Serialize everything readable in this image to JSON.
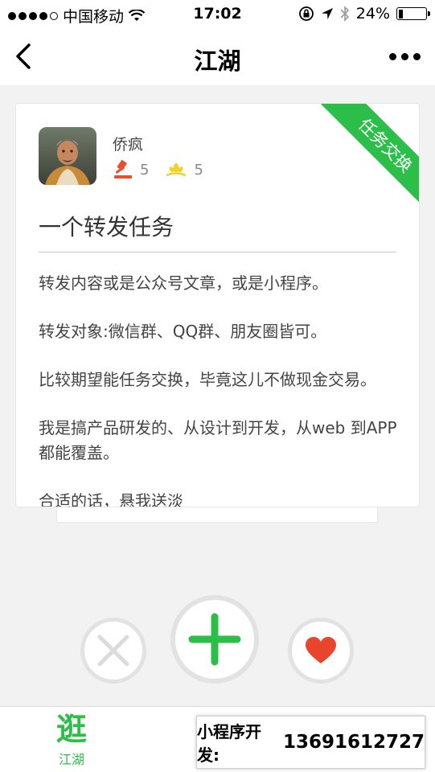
{
  "status_bar": {
    "carrier": "中国移动",
    "time": "17:02",
    "battery": "24%",
    "battery_level": 0.24
  },
  "nav": {
    "title": "江湖"
  },
  "card": {
    "ribbon": "任务交换",
    "username": "侨疯",
    "stat_hammer": "5",
    "stat_flower": "5",
    "title": "一个转发任务",
    "paragraphs": [
      "转发内容或是公众号文章，或是小程序。",
      "转发对象:微信群、QQ群、朋友圈皆可。",
      "比较期望能任务交换，毕竟这儿不做现金交易。",
      "我是搞产品研发的、从设计到开发，从web 到APP都能覆盖。",
      "合适的话，悬我送淡"
    ]
  },
  "tabbar": {
    "tab_icon_glyph": "逛",
    "tab_label": "江湖"
  },
  "promo": {
    "label": "小程序开发:",
    "phone": "13691612727"
  },
  "colors": {
    "accent_green": "#2bbf4a",
    "like_red": "#e8452c",
    "hammer_red": "#e2522e",
    "flower_yellow": "#f3d02a"
  },
  "icons": [
    "signal-dots-icon",
    "wifi-icon",
    "lock-rotation-icon",
    "location-arrow-icon",
    "bluetooth-icon",
    "battery-icon",
    "back-chevron-icon",
    "more-dots-icon",
    "hammer-icon",
    "flower-icon",
    "close-icon",
    "plus-icon",
    "heart-icon"
  ]
}
